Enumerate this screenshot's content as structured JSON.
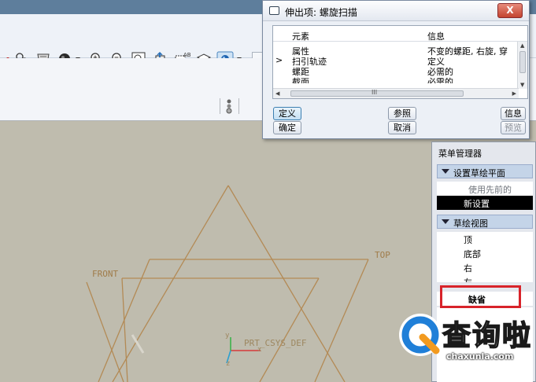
{
  "dialog": {
    "title": "伸出项: 螺旋扫描",
    "close_label": "X",
    "columns": {
      "element": "元素",
      "info": "信息"
    },
    "rows": [
      {
        "marker": "",
        "element": "属性",
        "info": "不变的螺距, 右旋, 穿"
      },
      {
        "marker": ">",
        "element": "扫引轨迹",
        "info": "定义"
      },
      {
        "marker": "",
        "element": "螺距",
        "info": "必需的"
      },
      {
        "marker": "",
        "element": "截面",
        "info": "必需的"
      }
    ],
    "scroll_grip": "III",
    "buttons": {
      "define": "定义",
      "reference": "参照",
      "info": "信息",
      "ok": "确定",
      "cancel": "取消",
      "preview": "预览"
    }
  },
  "menu_manager": {
    "title": "菜单管理器",
    "setup_sketch_plane": {
      "header": "设置草绘平面",
      "items": [
        "使用先前的",
        "新设置"
      ]
    },
    "sketch_view": {
      "header": "草绘视图",
      "items": [
        "顶",
        "底部",
        "右",
        "左",
        "缺省"
      ]
    }
  },
  "viewport": {
    "datum_labels": {
      "front": "FRONT",
      "top": "TOP",
      "csys": "PRT_CSYS_DEF"
    },
    "axis_labels": {
      "x": "x",
      "y": "y",
      "z": "z"
    }
  },
  "watermark": {
    "brand": "查询啦",
    "url": "chaxunla.com"
  },
  "colors": {
    "viewport_bg": "#bfbcae",
    "datum_plane": "#b38a55",
    "highlight_box": "#d8232a",
    "menu_section": "#c4d4e8"
  }
}
